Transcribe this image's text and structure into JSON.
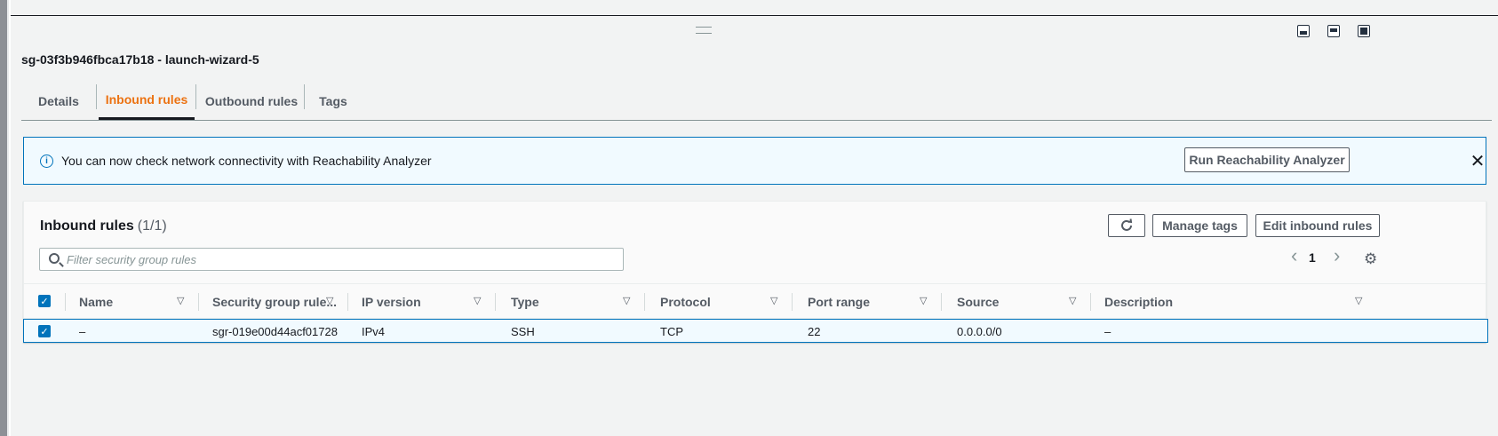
{
  "header": {
    "security_group_title": "sg-03f3b946fbca17b18 - launch-wizard-5"
  },
  "tabs": [
    {
      "label": "Details",
      "active": false
    },
    {
      "label": "Inbound rules",
      "active": true
    },
    {
      "label": "Outbound rules",
      "active": false
    },
    {
      "label": "Tags",
      "active": false
    }
  ],
  "alert": {
    "icon": "info-icon",
    "message": "You can now check network connectivity with Reachability Analyzer",
    "button_label": "Run Reachability Analyzer",
    "close_symbol": "✕"
  },
  "rules_panel": {
    "title": "Inbound rules",
    "count": "(1/1)",
    "refresh_icon": "refresh-icon",
    "manage_tags_label": "Manage tags",
    "edit_label": "Edit inbound rules",
    "search_placeholder": "Filter security group rules",
    "page_number": "1",
    "prev_symbol": "‹",
    "next_symbol": "›"
  },
  "table": {
    "columns": [
      "Name",
      "Security group rule...",
      "IP version",
      "Type",
      "Protocol",
      "Port range",
      "Source",
      "Description"
    ],
    "rows": [
      {
        "selected": true,
        "name": "–",
        "rule_id": "sgr-019e00d44acf01728",
        "ip_version": "IPv4",
        "type": "SSH",
        "protocol": "TCP",
        "port_range": "22",
        "source": "0.0.0.0/0",
        "description": "–"
      }
    ]
  },
  "colors": {
    "accent_orange": "#ec7211",
    "link_blue": "#0073bb",
    "text_dark": "#16191f",
    "text_muted": "#545b64"
  }
}
